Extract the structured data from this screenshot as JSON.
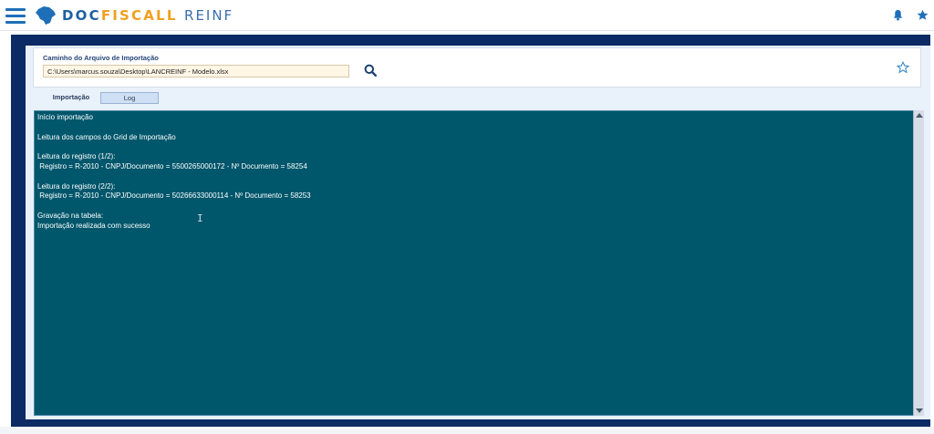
{
  "header": {
    "brand_doc": "DOC",
    "brand_fiscall": "FISCALL",
    "brand_reinf": "REINF",
    "icons": [
      "menu-icon",
      "brazil-map-logo",
      "bell-icon",
      "star-icon"
    ]
  },
  "import_panel": {
    "path_label": "Caminho do Arquivo de Importação",
    "path_value": "C:\\Users\\marcus.souza\\Desktop\\LANCREINF - Modelo.xlsx",
    "search_icon": "search-icon",
    "favorite_icon": "star-outline-icon"
  },
  "tabs": {
    "importacao": "Importação",
    "log": "Log",
    "active": "Log"
  },
  "log": {
    "text": "Início importação\n\nLeitura dos campos do Grid de Importação\n\nLeitura do registro (1/2):\n Registro = R-2010 - CNPJ/Documento = 5500265000172 - Nº Documento = 58254\n\nLeitura do registro (2/2):\n Registro = R-2010 - CNPJ/Documento = 50266633000114 - Nº Documento = 58253\n\nGravação na tabela:\nImportação realizada com sucesso"
  },
  "colors": {
    "brand_blue": "#1f5fa3",
    "brand_orange": "#f0a020",
    "frame_navy": "#0c2a63",
    "log_background": "#00566b"
  }
}
